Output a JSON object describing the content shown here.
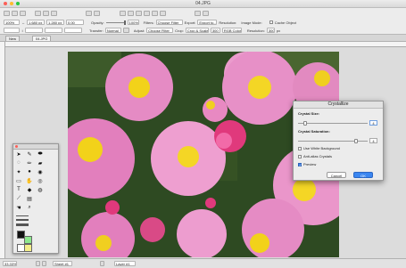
{
  "window": {
    "title": "04.JPG"
  },
  "toolbar": {
    "zoom": "100%",
    "width": "1,680 px",
    "height": "1,280 px",
    "angle": "0.00",
    "opacity_label": "Opacity:",
    "opacity_value": "100%",
    "transfer_label": "Transfer:",
    "transfer_value": "Normal",
    "filters_label": "Filters:",
    "filters_value": "Choose Filter",
    "adjust_label": "Adjust:",
    "adjust_value": "Choose Filter",
    "export_label": "Export:",
    "export_value": "Export to...",
    "crop_label": "Crop:",
    "crop_value": "Crop & Scale",
    "resolution_label": "Resolution:",
    "resolution_value": "300",
    "image_mode_label": "Image Mode:",
    "image_mode_value": "RGB Color",
    "cache_label": "Cache Object",
    "res2_label": "Resolution:",
    "res2_value": "300",
    "res2_unit": "px"
  },
  "tabs": [
    {
      "label": "New"
    },
    {
      "label": "04.JPG"
    }
  ],
  "status": {
    "zoom": "33.33%",
    "page": "Sheet #1",
    "layer": "Layer #1"
  },
  "dialog": {
    "title": "Crystallize",
    "size_label": "Crystal Size:",
    "size_value": "4",
    "size_fraction": 0.08,
    "saturation_label": "Crystal Saturation:",
    "saturation_value": "4",
    "saturation_fraction": 0.85,
    "white_bg_label": "Use White Background",
    "white_bg_checked": false,
    "antialias_label": "Anti-alias Crystals",
    "antialias_checked": false,
    "preview_label": "Preview",
    "preview_checked": true,
    "cancel_label": "Cancel",
    "ok_label": "OK"
  },
  "colors": {
    "accent": "#3b86f0",
    "petal": "#e88cc4",
    "center": "#f2d21a",
    "foliage": "#2e4a22"
  }
}
